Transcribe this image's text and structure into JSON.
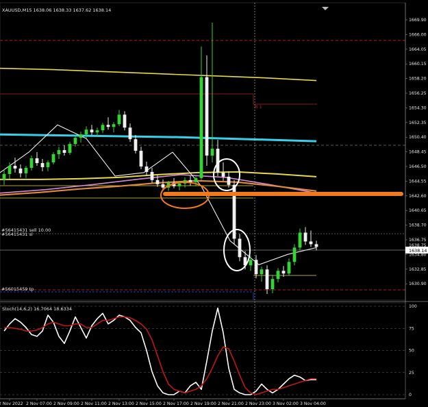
{
  "window": {
    "title": "XAUUSD,M15",
    "ohlc_header": "XAUUSD,M15  1638.06 1638.33 1637.62 1638.14"
  },
  "colors": {
    "background": "#000000",
    "bull_candle": "#35d435",
    "bear_candle": "#f0f0f0",
    "ma_yellow": "#e8d84a",
    "ma_cyan": "#37d2ea",
    "ma_pink": "#d68ad6",
    "ma_orange": "#e08a3c",
    "ma_white": "#f0f0f0",
    "annotation_orange": "#f07a1e",
    "red_dashed": "#b01e1e",
    "stoch_main": "#ffffff",
    "stoch_signal": "#c01818"
  },
  "chart_data": [
    {
      "type": "line",
      "title": "XAUUSD,M15",
      "y_ticks": [
        "1669.90",
        "1666.00",
        "1664.05",
        "1660.15",
        "1658.20",
        "1656.25",
        "1654.30",
        "1652.35",
        "1650.40",
        "1648.45",
        "1646.50",
        "1644.55",
        "1642.60",
        "1640.65",
        "1638.70",
        "1636.75",
        "1634.80",
        "1632.85",
        "1630.90"
      ],
      "ylim": [
        1630.3,
        1671.5
      ],
      "x_ticks": [
        "2 Nov 2022",
        "2 Nov 07:00",
        "2 Nov 09:00",
        "2 Nov 11:00",
        "2 Nov 13:00",
        "2 Nov 15:00",
        "2 Nov 17:00",
        "2 Nov 19:00",
        "2 Nov 21:00",
        "2 Nov 23:00",
        "3 Nov 02:00",
        "3 Nov 04:00"
      ],
      "current_price": "1638.14",
      "price_marker": "1638.75",
      "order_labels": [
        "#56415431 sell 10.00",
        "#56415431 sl",
        "#56015459 tp"
      ],
      "text_marker": "R 1",
      "series": [
        {
          "name": "",
          "values": [
            1664.3,
            1664.1,
            1663.8,
            1663.5,
            1663.2,
            1662.9,
            1662.5
          ]
        },
        {
          "name": "",
          "values": [
            1654.6,
            1654.5,
            1654.4,
            1654.3,
            1654.2,
            1654.0,
            1653.8,
            1653.6
          ]
        },
        {
          "name": "",
          "values": [
            1648.0,
            1648.0,
            1648.1,
            1648.3,
            1648.7,
            1649.0,
            1649.1,
            1648.8,
            1648.4
          ]
        },
        {
          "name": "",
          "values": [
            1646.0,
            1646.5,
            1647.2,
            1648.0,
            1648.7,
            1648.3,
            1647.2,
            1646.0
          ]
        },
        {
          "name": "",
          "values": [
            1645.7,
            1646.1,
            1646.6,
            1647.0,
            1647.5,
            1647.8,
            1647.6,
            1647.0,
            1646.3
          ]
        },
        {
          "name": "",
          "values": [
            1649.0,
            1652.0,
            1656.0,
            1654.0,
            1648.5,
            1649.0,
            1652.0,
            1647.0,
            1639.0,
            1635.5,
            1637.0,
            1638.0
          ]
        }
      ],
      "candles": [
        [
          1648.0,
          1649.5,
          1647.2,
          1648.8
        ],
        [
          1648.8,
          1650.5,
          1648.1,
          1650.0
        ],
        [
          1650.0,
          1651.2,
          1649.0,
          1649.6
        ],
        [
          1649.6,
          1650.2,
          1648.3,
          1648.9
        ],
        [
          1648.9,
          1650.0,
          1648.2,
          1649.7
        ],
        [
          1649.7,
          1651.5,
          1649.3,
          1651.1
        ],
        [
          1651.1,
          1652.0,
          1650.0,
          1650.4
        ],
        [
          1650.4,
          1651.0,
          1649.2,
          1649.8
        ],
        [
          1649.8,
          1650.8,
          1649.2,
          1650.5
        ],
        [
          1650.5,
          1652.0,
          1650.2,
          1651.7
        ],
        [
          1651.7,
          1652.8,
          1651.0,
          1652.3
        ],
        [
          1652.3,
          1653.0,
          1651.5,
          1651.9
        ],
        [
          1651.9,
          1653.5,
          1651.6,
          1653.2
        ],
        [
          1653.2,
          1654.5,
          1652.8,
          1654.1
        ],
        [
          1654.1,
          1655.0,
          1653.4,
          1654.6
        ],
        [
          1654.6,
          1655.8,
          1654.0,
          1655.3
        ],
        [
          1655.3,
          1656.0,
          1654.5,
          1654.9
        ],
        [
          1654.9,
          1655.6,
          1654.3,
          1655.2
        ],
        [
          1655.2,
          1656.3,
          1654.8,
          1656.0
        ],
        [
          1656.0,
          1657.1,
          1655.3,
          1655.7
        ],
        [
          1655.7,
          1656.4,
          1654.9,
          1656.1
        ],
        [
          1656.1,
          1658.2,
          1655.8,
          1657.5
        ],
        [
          1657.5,
          1658.0,
          1655.2,
          1655.6
        ],
        [
          1655.6,
          1656.2,
          1653.5,
          1653.9
        ],
        [
          1653.9,
          1654.5,
          1651.8,
          1652.2
        ],
        [
          1652.2,
          1652.8,
          1649.5,
          1649.9
        ],
        [
          1649.9,
          1650.6,
          1648.6,
          1649.1
        ],
        [
          1649.1,
          1649.7,
          1647.5,
          1647.9
        ],
        [
          1647.9,
          1648.6,
          1646.9,
          1647.3
        ],
        [
          1647.3,
          1648.0,
          1646.4,
          1646.8
        ],
        [
          1646.8,
          1647.8,
          1646.3,
          1647.5
        ],
        [
          1647.5,
          1648.2,
          1646.7,
          1647.0
        ],
        [
          1647.0,
          1647.8,
          1646.4,
          1647.4
        ],
        [
          1647.4,
          1648.3,
          1646.8,
          1647.9
        ],
        [
          1647.9,
          1648.5,
          1647.1,
          1647.6
        ],
        [
          1647.6,
          1648.5,
          1647.0,
          1648.2
        ],
        [
          1648.2,
          1667.5,
          1647.9,
          1663.0
        ],
        [
          1663.0,
          1666.2,
          1650.0,
          1651.5
        ],
        [
          1651.5,
          1671.0,
          1650.5,
          1652.5
        ],
        [
          1652.5,
          1653.8,
          1648.5,
          1649.0
        ],
        [
          1649.0,
          1650.5,
          1647.8,
          1648.4
        ],
        [
          1648.4,
          1649.2,
          1646.8,
          1647.2
        ],
        [
          1647.2,
          1647.9,
          1638.5,
          1639.3
        ],
        [
          1639.3,
          1640.0,
          1636.0,
          1636.6
        ],
        [
          1636.6,
          1637.5,
          1634.8,
          1635.4
        ],
        [
          1635.4,
          1636.8,
          1634.6,
          1636.2
        ],
        [
          1636.2,
          1636.9,
          1633.5,
          1634.1
        ],
        [
          1634.1,
          1635.2,
          1633.0,
          1634.8
        ],
        [
          1634.8,
          1635.4,
          1631.2,
          1631.9
        ],
        [
          1631.9,
          1634.0,
          1631.3,
          1633.4
        ],
        [
          1633.4,
          1635.0,
          1632.9,
          1634.6
        ],
        [
          1634.6,
          1635.3,
          1633.7,
          1634.2
        ],
        [
          1634.2,
          1636.4,
          1633.9,
          1635.9
        ],
        [
          1635.9,
          1638.5,
          1635.4,
          1638.0
        ],
        [
          1638.0,
          1640.8,
          1637.6,
          1640.2
        ],
        [
          1640.2,
          1641.0,
          1638.4,
          1638.9
        ],
        [
          1638.9,
          1640.5,
          1638.1,
          1638.5
        ],
        [
          1638.5,
          1639.0,
          1637.6,
          1638.1
        ]
      ]
    },
    {
      "type": "line",
      "title": "Stoch(14,6,2) 16.7064 18.6334",
      "y_ticks": [
        "100",
        "75",
        "50",
        "25",
        "0"
      ],
      "ylim": [
        0,
        100
      ],
      "x_ticks": [
        "2 Nov 2022",
        "2 Nov 07:00",
        "2 Nov 09:00",
        "2 Nov 11:00",
        "2 Nov 13:00",
        "2 Nov 15:00",
        "2 Nov 17:00",
        "2 Nov 19:00",
        "2 Nov 21:00",
        "2 Nov 23:00",
        "3 Nov 02:00",
        "3 Nov 04:00"
      ],
      "series": [
        {
          "name": "",
          "values": [
            72,
            80,
            86,
            82,
            76,
            68,
            66,
            72,
            90,
            82,
            66,
            58,
            72,
            88,
            76,
            64,
            78,
            86,
            92,
            80,
            84,
            90,
            88,
            84,
            76,
            70,
            50,
            26,
            10,
            2,
            0,
            0,
            4,
            2,
            10,
            14,
            6,
            38,
            72,
            98,
            70,
            30,
            6,
            2,
            0,
            0,
            4,
            12,
            6,
            2,
            6,
            12,
            18,
            22,
            20,
            16,
            17,
            17
          ]
        },
        {
          "name": "",
          "values": [
            76,
            76,
            75,
            74,
            72,
            72,
            73,
            76,
            80,
            82,
            80,
            78,
            78,
            80,
            80,
            76,
            76,
            80,
            84,
            84,
            86,
            88,
            88,
            87,
            84,
            80,
            74,
            62,
            44,
            26,
            12,
            6,
            4,
            2,
            4,
            6,
            10,
            18,
            30,
            44,
            54,
            52,
            38,
            22,
            8,
            2,
            0,
            2,
            4,
            6,
            6,
            8,
            10,
            12,
            14,
            16,
            18,
            18
          ]
        }
      ]
    }
  ]
}
